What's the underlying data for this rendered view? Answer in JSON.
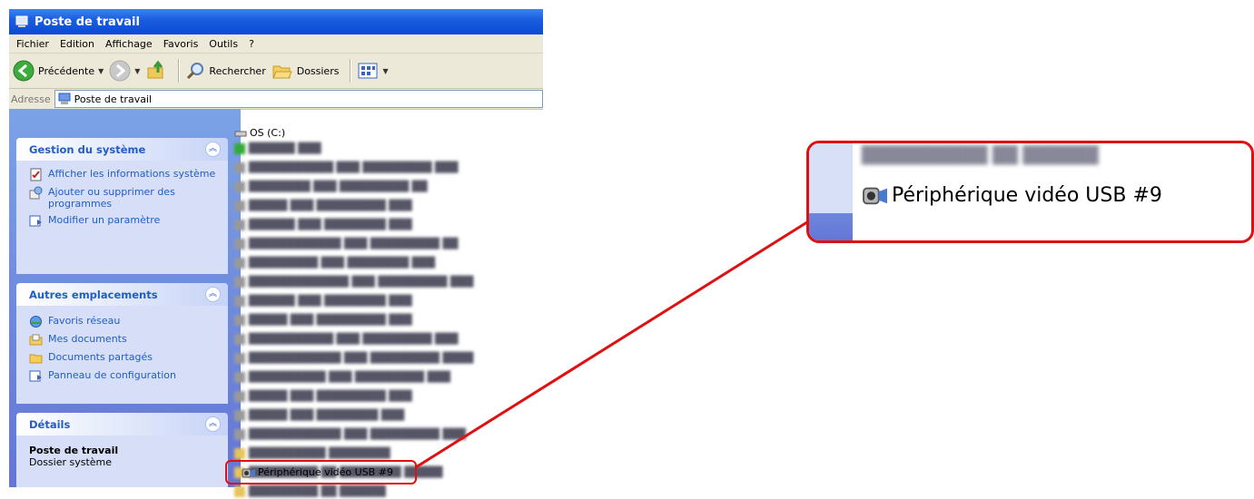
{
  "window": {
    "title": "Poste de travail"
  },
  "menu": [
    "Fichier",
    "Edition",
    "Affichage",
    "Favoris",
    "Outils",
    "?"
  ],
  "toolbar": {
    "back": "Précédente",
    "search": "Rechercher",
    "folders": "Dossiers"
  },
  "address": {
    "label": "Adresse",
    "value": "Poste de travail"
  },
  "taskpane": {
    "system": {
      "title": "Gestion du système",
      "items": [
        "Afficher les informations système",
        "Ajouter ou supprimer des programmes",
        "Modifier un paramètre"
      ]
    },
    "places": {
      "title": "Autres emplacements",
      "items": [
        "Favoris réseau",
        "Mes documents",
        "Documents partagés",
        "Panneau de configuration"
      ]
    },
    "details": {
      "title": "Détails",
      "name": "Poste de travail",
      "type": "Dossier système"
    }
  },
  "files": {
    "drive": "OS (C:)",
    "device": "Périphérique vidéo USB #9"
  },
  "callout": {
    "label": "Périphérique vidéo USB #9"
  },
  "colors": {
    "highlight": "#e01010",
    "title_blue": "#0a4ad6",
    "link_blue": "#215dc6"
  }
}
